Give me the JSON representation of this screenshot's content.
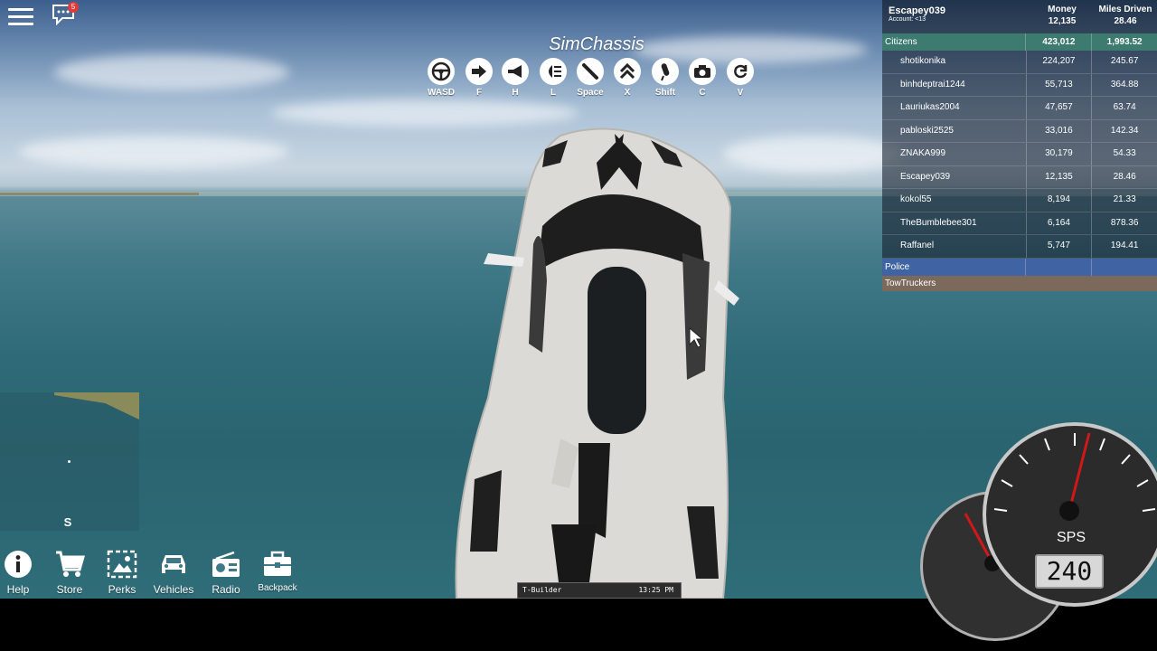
{
  "hud": {
    "chat_badge": "5",
    "title": "SimChassis"
  },
  "controls": [
    {
      "icon": "steering-wheel-icon",
      "key": "WASD"
    },
    {
      "icon": "exit-arrow-icon",
      "key": "F"
    },
    {
      "icon": "horn-icon",
      "key": "H"
    },
    {
      "icon": "headlight-icon",
      "key": "L"
    },
    {
      "icon": "handbrake-icon",
      "key": "Space"
    },
    {
      "icon": "chevron-up-double-icon",
      "key": "X"
    },
    {
      "icon": "gear-shift-icon",
      "key": "Shift"
    },
    {
      "icon": "camera-icon",
      "key": "C"
    },
    {
      "icon": "refresh-icon",
      "key": "V"
    }
  ],
  "leaderboard": {
    "player_name": "Escapey039",
    "account_age": "Account: <13",
    "columns": [
      "Money",
      "Miles Driven"
    ],
    "player_money": "12,135",
    "player_miles": "28.46",
    "citizens": {
      "label": "Citizens",
      "money": "423,012",
      "miles": "1,993.52"
    },
    "rows": [
      {
        "name": "shotikonika",
        "money": "224,207",
        "miles": "245.67"
      },
      {
        "name": "binhdeptrai1244",
        "money": "55,713",
        "miles": "364.88"
      },
      {
        "name": "Lauriukas2004",
        "money": "47,657",
        "miles": "63.74"
      },
      {
        "name": "pabloski2525",
        "money": "33,016",
        "miles": "142.34"
      },
      {
        "name": "ZNAKA999",
        "money": "30,179",
        "miles": "54.33"
      },
      {
        "name": "Escapey039",
        "money": "12,135",
        "miles": "28.46"
      },
      {
        "name": "kokol55",
        "money": "8,194",
        "miles": "21.33"
      },
      {
        "name": "TheBumblebee301",
        "money": "6,164",
        "miles": "878.36"
      },
      {
        "name": "Raffanel",
        "money": "5,747",
        "miles": "194.41"
      }
    ],
    "police": {
      "label": "Police"
    },
    "tow": {
      "label": "TowTruckers"
    }
  },
  "minimap": {
    "direction": "S"
  },
  "toolbar": [
    {
      "icon": "info-icon",
      "label": "Help"
    },
    {
      "icon": "cart-icon",
      "label": "Store"
    },
    {
      "icon": "perks-icon",
      "label": "Perks"
    },
    {
      "icon": "car-icon",
      "label": "Vehicles"
    },
    {
      "icon": "radio-icon",
      "label": "Radio"
    },
    {
      "icon": "backpack-icon",
      "label": "Backpack"
    }
  ],
  "taskbar": {
    "app": "T-Builder",
    "clock": "13:25 PM"
  },
  "speedometer": {
    "unit": "SPS",
    "value": "240"
  },
  "colors": {
    "citizens": "#3d7a70",
    "police": "#3f63a3",
    "tow": "#7b6a5c"
  }
}
